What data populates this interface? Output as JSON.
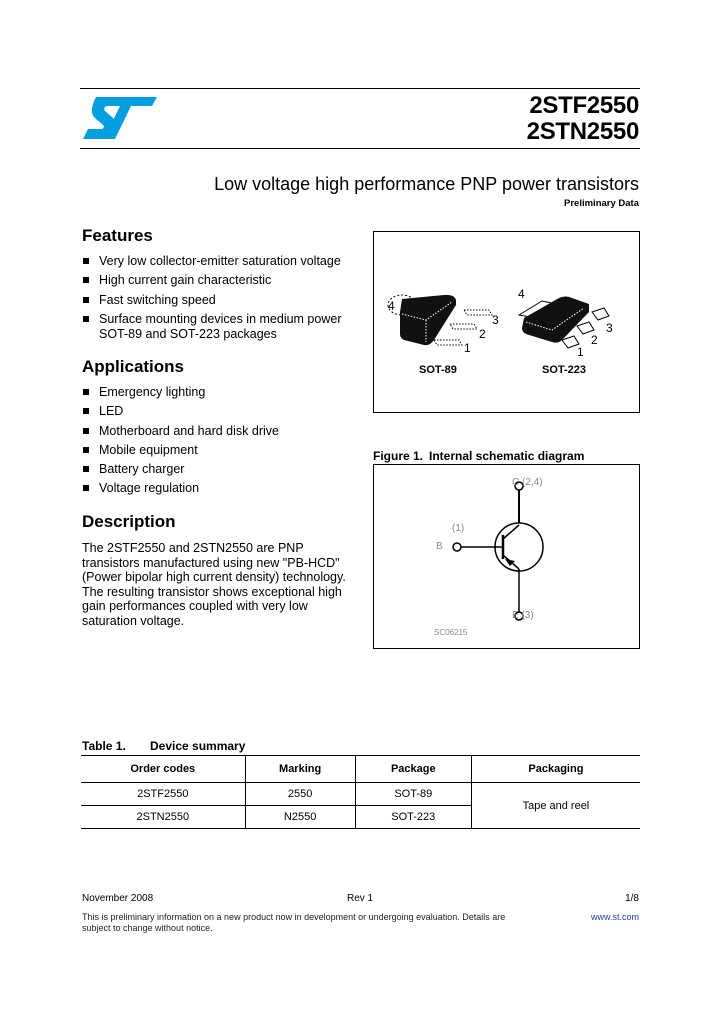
{
  "header": {
    "logo": "st-logo",
    "logo_color": "#00a0e0",
    "part_numbers": [
      "2STF2550",
      "2STN2550"
    ],
    "subtitle": "Low voltage high performance PNP power transistors",
    "status": "Preliminary Data"
  },
  "features": {
    "title": "Features",
    "items": [
      "Very low collector-emitter saturation voltage",
      "High current gain characteristic",
      "Fast switching speed",
      "Surface mounting devices in medium power SOT-89 and SOT-223 packages"
    ]
  },
  "applications": {
    "title": "Applications",
    "items": [
      "Emergency lighting",
      "LED",
      "Motherboard and hard disk drive",
      "Mobile equipment",
      "Battery charger",
      "Voltage regulation"
    ]
  },
  "description": {
    "title": "Description",
    "text": "The 2STF2550 and 2STN2550 are PNP transistors manufactured using new \"PB-HCD\" (Power bipolar high current density) technology. The resulting transistor shows exceptional high gain performances coupled with very low saturation voltage."
  },
  "packages": {
    "sot89": {
      "label": "SOT-89",
      "pins": [
        "1",
        "2",
        "3",
        "4"
      ]
    },
    "sot223": {
      "label": "SOT-223",
      "pins": [
        "1",
        "2",
        "3",
        "4"
      ]
    }
  },
  "figure": {
    "number": "Figure 1.",
    "title": "Internal schematic diagram",
    "collector_label": "C (2,4)",
    "base_label": "B",
    "base_pin": "(1)",
    "emitter_label": "E (3)",
    "code": "SC06215"
  },
  "table": {
    "number": "Table 1.",
    "title": "Device summary",
    "headers": [
      "Order codes",
      "Marking",
      "Package",
      "Packaging"
    ],
    "rows": [
      [
        "2STF2550",
        "2550",
        "SOT-89"
      ],
      [
        "2STN2550",
        "N2550",
        "SOT-223"
      ]
    ],
    "packaging_merged": "Tape and reel"
  },
  "footer": {
    "date": "November 2008",
    "revision": "Rev 1",
    "page": "1/8",
    "note": "This is preliminary information on a new product now in development or undergoing evaluation. Details are subject to change without notice.",
    "website": "www.st.com"
  }
}
